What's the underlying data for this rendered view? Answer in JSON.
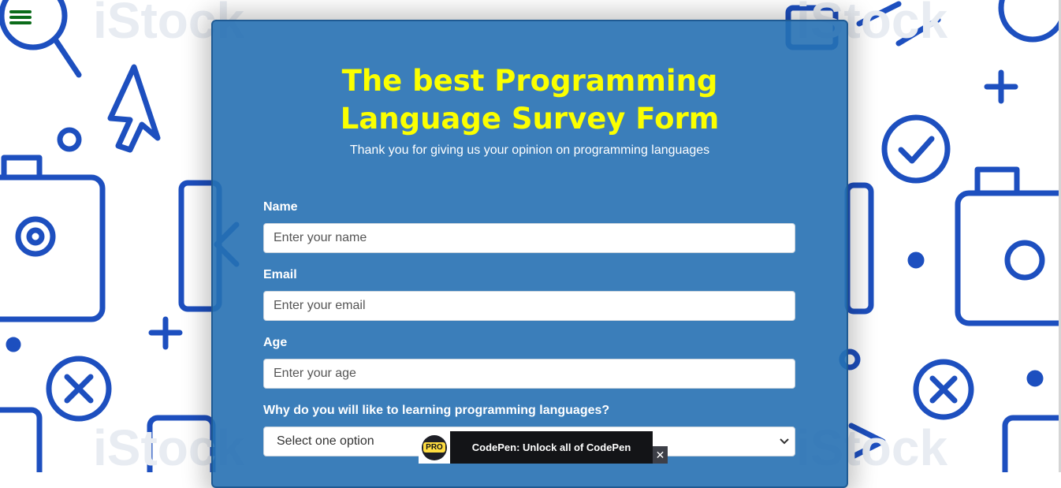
{
  "form": {
    "title_line1": "The best Programming",
    "title_line2": "Language Survey Form",
    "description": "Thank you for giving us your opinion on programming languages",
    "name_label": "Name",
    "name_placeholder": "Enter your name",
    "email_label": "Email",
    "email_placeholder": "Enter your email",
    "age_label": "Age",
    "age_placeholder": "Enter your age",
    "reason_label": "Why do you will like to learning programming languages?",
    "reason_selected": "Select one option"
  },
  "promo": {
    "badge": "PRO",
    "text": "CodePen: Unlock all of CodePen",
    "close": "✕"
  },
  "icons": {
    "menu": "hamburger-menu-icon",
    "dropdown": "chevron-down-icon",
    "close": "close-icon"
  },
  "colors": {
    "title": "#fbff00",
    "card": "#2670b2",
    "menu": "#0b6b1a",
    "pattern": "#1d4fbf"
  }
}
